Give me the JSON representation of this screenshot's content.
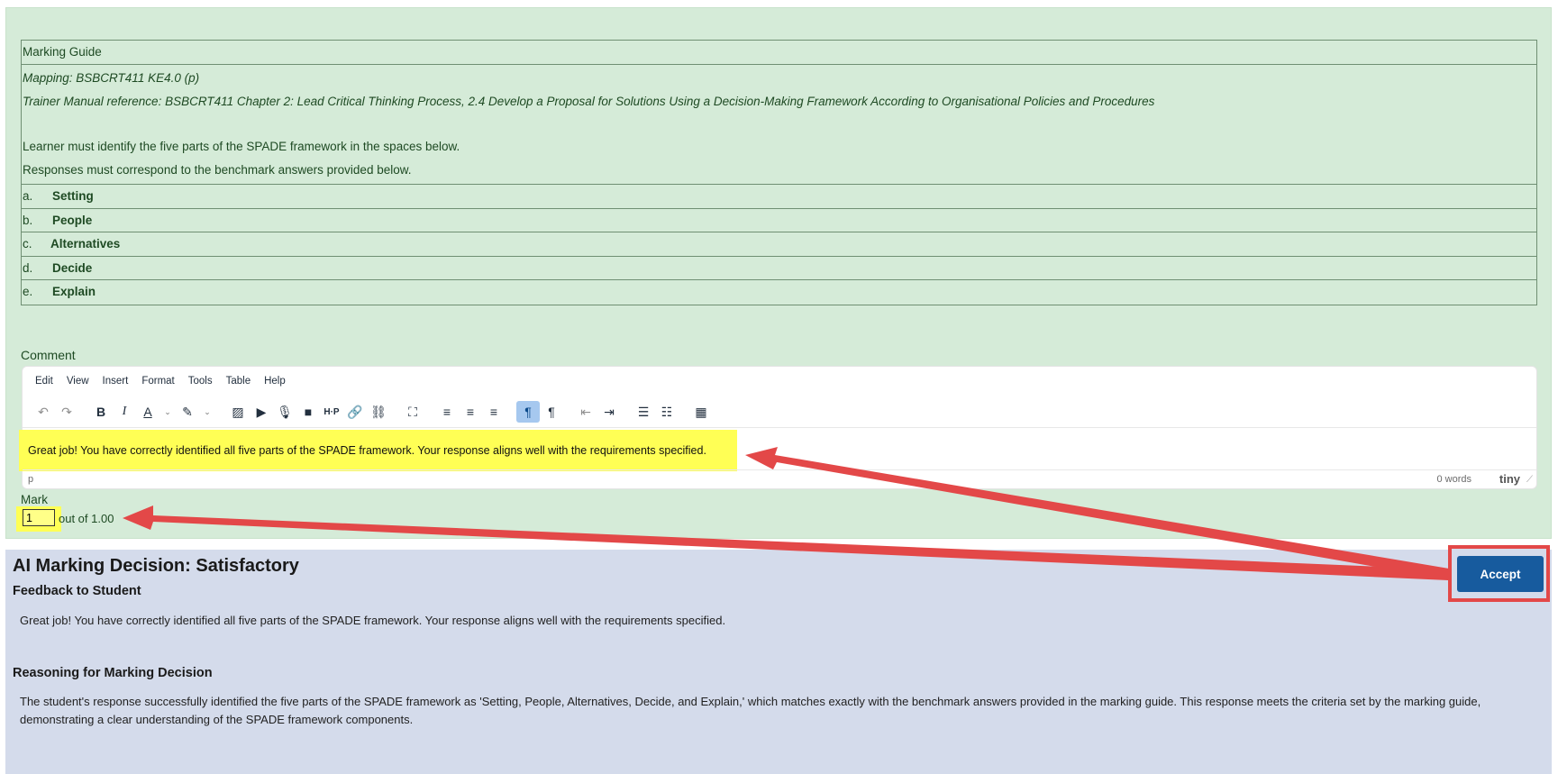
{
  "marking_guide": {
    "header": "Marking Guide",
    "mapping": "Mapping: BSBCRT411 KE4.0 (p)",
    "reference": "Trainer Manual reference: BSBCRT411 Chapter 2: Lead Critical Thinking Process, 2.4 Develop a Proposal for Solutions Using a Decision-Making Framework According to Organisational Policies and Procedures",
    "instruction_1": "Learner must identify the five parts of the SPADE framework in the spaces below.",
    "instruction_2": "Responses must correspond to the benchmark answers provided below.",
    "items": [
      {
        "letter": "a.",
        "text": "Setting"
      },
      {
        "letter": "b.",
        "text": "People"
      },
      {
        "letter": "c.",
        "text": "Alternatives"
      },
      {
        "letter": "d.",
        "text": "Decide"
      },
      {
        "letter": "e.",
        "text": "Explain"
      }
    ]
  },
  "comment": {
    "label": "Comment",
    "menu": [
      "Edit",
      "View",
      "Insert",
      "Format",
      "Tools",
      "Table",
      "Help"
    ],
    "content": "Great job! You have correctly identified all five parts of the SPADE framework. Your response aligns well with the requirements specified.",
    "status_path": "p",
    "word_count": "0 words",
    "brand": "tiny"
  },
  "mark": {
    "label": "Mark",
    "value": "1",
    "suffix": "out of 1.00"
  },
  "ai": {
    "title": "AI Marking Decision: Satisfactory",
    "feedback_heading": "Feedback to Student",
    "feedback": "Great job! You have correctly identified all five parts of the SPADE framework. Your response aligns well with the requirements specified.",
    "reasoning_heading": "Reasoning for Marking Decision",
    "reasoning": "The student's response successfully identified the five parts of the SPADE framework as 'Setting, People, Alternatives, Decide, and Explain,' which matches exactly with the benchmark answers provided in the marking guide. This response meets the criteria set by the marking guide, demonstrating a clear understanding of the SPADE framework components.",
    "accept_label": "Accept"
  },
  "colors": {
    "green_panel": "#d5ebd8",
    "ai_panel": "#d4dbeb",
    "highlight": "#ffff55",
    "accept_button": "#175b9e",
    "annotation_red": "#e34848"
  },
  "icons": [
    "undo-icon",
    "redo-icon",
    "bold-icon",
    "italic-icon",
    "text-color-icon",
    "highlight-color-icon",
    "image-icon",
    "media-icon",
    "microphone-icon",
    "video-icon",
    "h5p-icon",
    "link-icon",
    "unlink-icon",
    "fullscreen-icon",
    "align-left-icon",
    "align-center-icon",
    "align-right-icon",
    "ltr-icon",
    "rtl-icon",
    "outdent-icon",
    "indent-icon",
    "bullet-list-icon",
    "numbered-list-icon",
    "calculator-icon",
    "tiny-logo-icon",
    "resize-handle-icon"
  ]
}
